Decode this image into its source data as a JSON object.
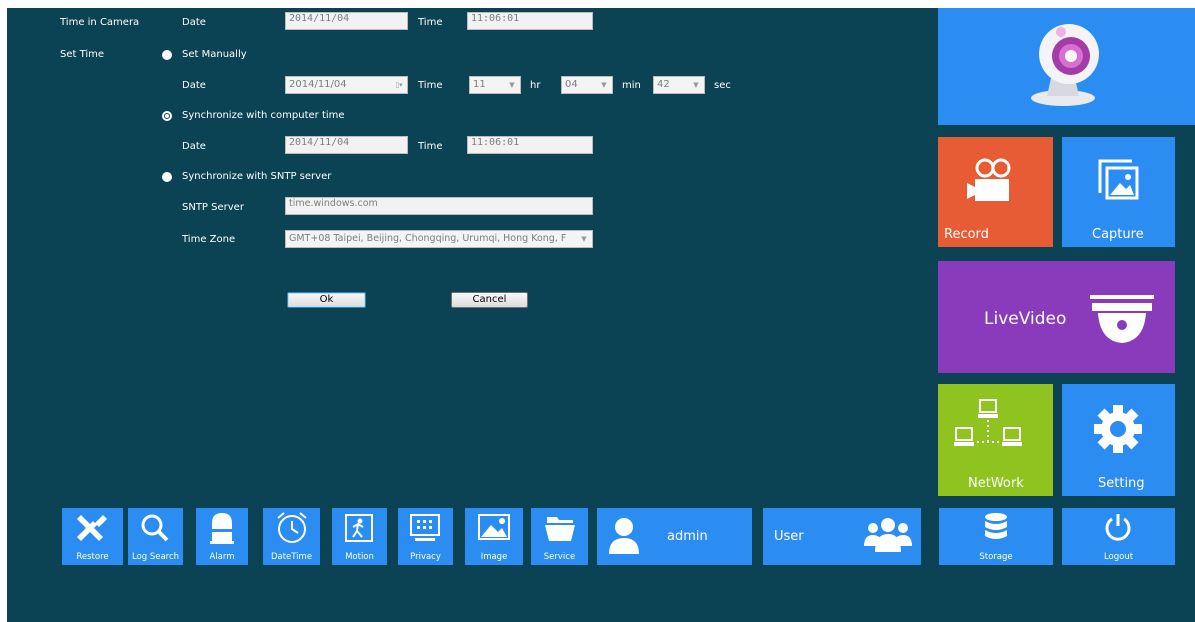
{
  "form": {
    "time_in_camera": {
      "label": "Time in Camera",
      "date_label": "Date",
      "date": "2014/11/04",
      "time_label": "Time",
      "time": "11:06:01"
    },
    "set_time": {
      "label": "Set Time",
      "manual": {
        "label": "Set Manually",
        "date_label": "Date",
        "date": "2014/11/04",
        "time_label": "Time",
        "hour": "11",
        "hr": "hr",
        "minute": "04",
        "min": "min",
        "second": "42",
        "sec": "sec"
      },
      "sync_computer": {
        "label": "Synchronize with computer time",
        "date_label": "Date",
        "date": "2014/11/04",
        "time_label": "Time",
        "time": "11:06:01"
      },
      "sync_sntp": {
        "label": "Synchronize with SNTP server",
        "server_label": "SNTP Server",
        "server": "time.windows.com",
        "tz_label": "Time Zone",
        "tz": "GMT+08 Taipei, Beijing, Chongqing, Urumqi, Hong Kong, F"
      }
    },
    "ok": "Ok",
    "cancel": "Cancel"
  },
  "tiles": {
    "record": "Record",
    "capture": "Capture",
    "livevideo": "LiveVideo",
    "network": "NetWork",
    "setting": "Setting",
    "storage": "Storage",
    "logout": "Logout"
  },
  "toolbar": {
    "restore": "Restore",
    "log_search": "Log Search",
    "alarm": "Alarm",
    "datetime": "DateTime",
    "motion": "Motion",
    "privacy": "Privacy",
    "image": "Image",
    "service": "Service",
    "admin": "admin",
    "user": "User"
  },
  "colors": {
    "background": "#0b4354",
    "blue": "#2b8df2",
    "orange": "#e85c35",
    "purple": "#8a3bbc",
    "green": "#8fc31f"
  },
  "icons": [
    "webcam-icon",
    "video-camera-icon",
    "photos-icon",
    "dome-camera-icon",
    "network-icon",
    "gear-icon",
    "wrench-icon",
    "search-icon",
    "alarm-icon",
    "clock-icon",
    "running-person-icon",
    "privacy-icon",
    "image-icon",
    "folder-icon",
    "person-icon",
    "group-icon",
    "database-icon",
    "power-icon"
  ]
}
